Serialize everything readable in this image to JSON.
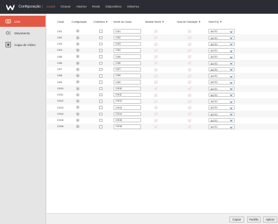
{
  "header": {
    "title": "Configuração",
    "nav": [
      "Canal",
      "Gravar",
      "Alarme",
      "Rede",
      "Dispositivo",
      "Sistema"
    ],
    "active_nav": "Canal"
  },
  "sidebar": {
    "items": [
      {
        "label": "Live",
        "icon": "camera-icon",
        "active": true
      },
      {
        "label": "Movimento",
        "icon": "motion-icon",
        "active": false
      },
      {
        "label": "Capa de Vídeo",
        "icon": "video-cover-icon",
        "active": false
      }
    ]
  },
  "table": {
    "headers": [
      "Canal",
      "Configuração",
      "Cobertura",
      "Nome do Canal",
      "Mostrar Nome",
      "Hora de Gravação",
      "Nível EQ"
    ],
    "rows": [
      {
        "channel": "CH1",
        "name": "CH1",
        "eq": "AUTO"
      },
      {
        "channel": "CH2",
        "name": "CH2",
        "eq": "AUTO"
      },
      {
        "channel": "CH3",
        "name": "CH3",
        "eq": "AUTO"
      },
      {
        "channel": "CH4",
        "name": "CH4",
        "eq": "AUTO"
      },
      {
        "channel": "CH5",
        "name": "CH5",
        "eq": "AUTO"
      },
      {
        "channel": "CH6",
        "name": "CH6",
        "eq": "AUTO"
      },
      {
        "channel": "CH7",
        "name": "CH7",
        "eq": "AUTO"
      },
      {
        "channel": "CH8",
        "name": "CH8",
        "eq": "AUTO"
      },
      {
        "channel": "CH9",
        "name": "CH9",
        "eq": "AUTO"
      },
      {
        "channel": "CH10",
        "name": "CH10",
        "eq": "AUTO"
      },
      {
        "channel": "CH11",
        "name": "CH11",
        "eq": "AUTO"
      },
      {
        "channel": "CH12",
        "name": "CH12",
        "eq": "AUTO"
      },
      {
        "channel": "CH13",
        "name": "CH13",
        "eq": "AUTO"
      },
      {
        "channel": "CH14",
        "name": "CH14",
        "eq": "AUTO"
      },
      {
        "channel": "CH15",
        "name": "CH15",
        "eq": "AUTO"
      },
      {
        "channel": "CH16",
        "name": "CH16",
        "eq": "AUTO"
      }
    ]
  },
  "footer": {
    "copy": "Copiar",
    "default": "Padrão",
    "apply": "Aplicar"
  },
  "colors": {
    "accent": "#e25a45",
    "topbar": "#2a2d33",
    "check": "#e8a1a1"
  }
}
